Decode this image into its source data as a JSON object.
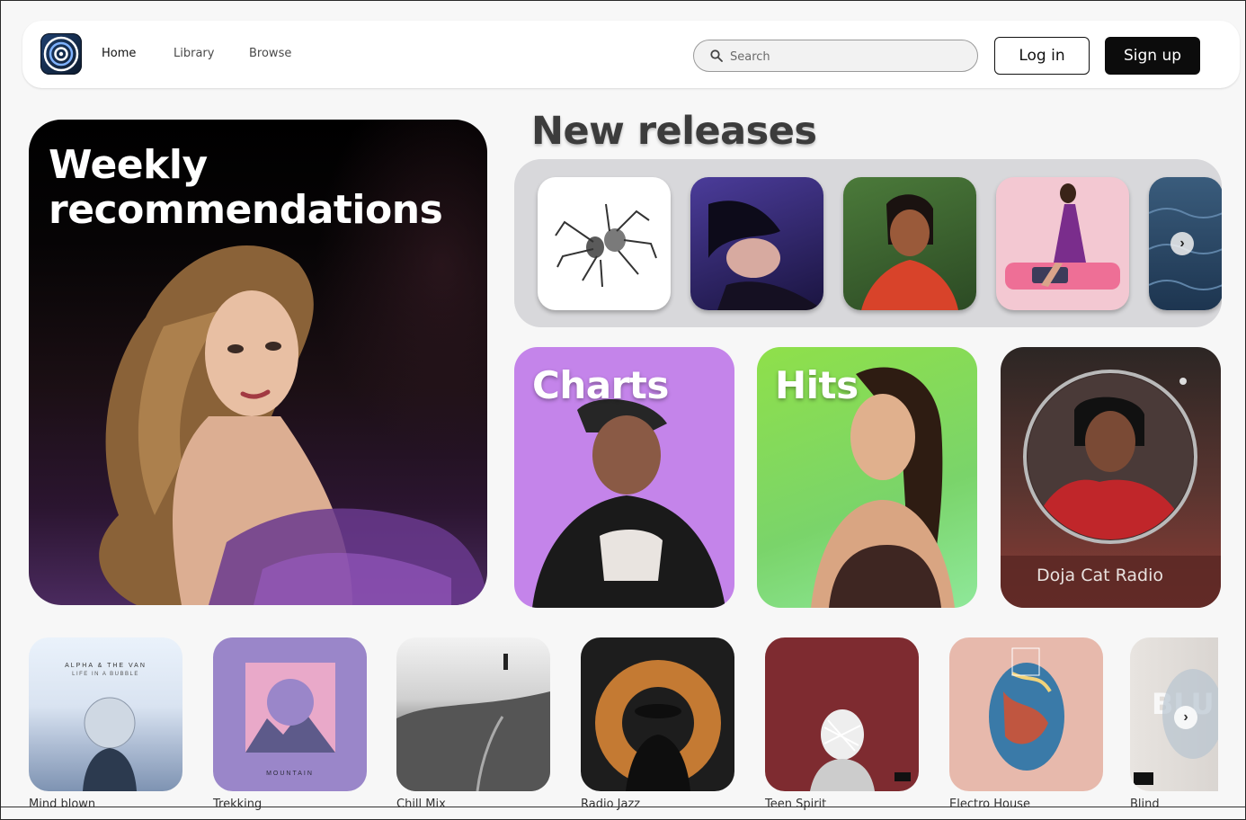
{
  "nav": {
    "logo": "app-logo",
    "links": [
      "Home",
      "Library",
      "Browse"
    ],
    "active": "Home"
  },
  "search": {
    "placeholder": "Search",
    "value": ""
  },
  "auth": {
    "login_label": "Log in",
    "signup_label": "Sign up"
  },
  "weekly": {
    "title_line1": "Weekly",
    "title_line2": "recommendations"
  },
  "new_releases": {
    "title": "New releases",
    "items": [
      {
        "name": "spider-album-cover",
        "bg": "#ffffff"
      },
      {
        "name": "purple-portrait-cover",
        "bg": "#3a2b78"
      },
      {
        "name": "green-red-portrait-cover",
        "bg": "#3f6b33"
      },
      {
        "name": "pink-portrait-cover",
        "bg": "#f2c6cf"
      },
      {
        "name": "ocean-cover",
        "bg": "#2a4a66"
      }
    ]
  },
  "features": {
    "charts": {
      "title": "Charts",
      "color": "#c484ea"
    },
    "hits": {
      "title": "Hits",
      "color": "#8fe04a"
    },
    "radio": {
      "label": "Doja Cat Radio"
    }
  },
  "playlists": [
    {
      "title": "Mind blown",
      "cover_text": "ALPHA & THE VAN",
      "cover_sub": "LIFE IN A BUBBLE"
    },
    {
      "title": "Trekking",
      "cover_text": "MOUNTAIN"
    },
    {
      "title": "Chill Mix"
    },
    {
      "title": "Radio Jazz"
    },
    {
      "title": "Teen Spirit"
    },
    {
      "title": "Electro House"
    },
    {
      "title": "Blind",
      "cover_text": "BLU"
    }
  ]
}
